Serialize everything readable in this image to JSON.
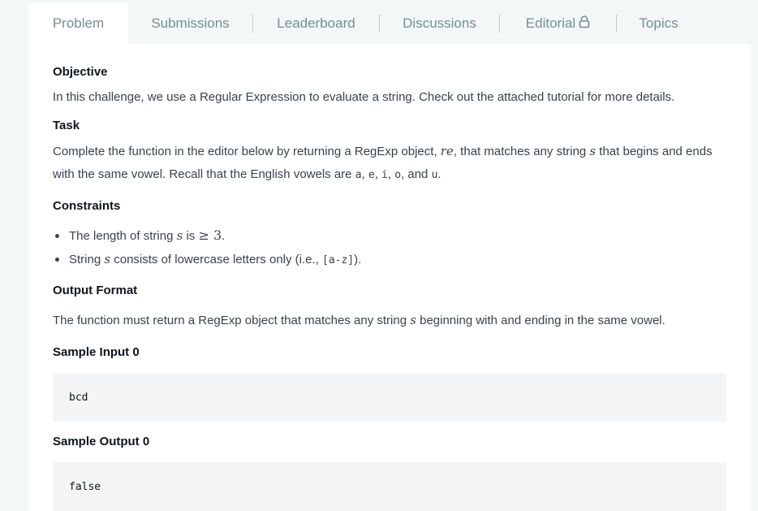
{
  "tabs": [
    {
      "label": "Problem",
      "active": true
    },
    {
      "label": "Submissions"
    },
    {
      "label": "Leaderboard"
    },
    {
      "label": "Discussions"
    },
    {
      "label": "Editorial"
    },
    {
      "label": "Topics"
    }
  ],
  "objective": {
    "heading": "Objective",
    "text": "In this challenge, we use a Regular Expression to evaluate a string. Check out the attached tutorial for more details."
  },
  "task": {
    "heading": "Task",
    "text_part1": "Complete the function in the editor below by returning a RegExp object, ",
    "var_re": "re",
    "text_part2": ", that matches any string ",
    "var_s": "s",
    "text_part3": " that begins and ends with the same vowel. Recall that the English vowels are ",
    "vowels": [
      "a",
      "e",
      "i",
      "o",
      "u"
    ],
    "text_sep1": ", ",
    "text_and": ", and ",
    "text_end": "."
  },
  "constraints": {
    "heading": "Constraints",
    "item1_part1": "The length of string ",
    "item1_var": "s",
    "item1_part2": " is ",
    "item1_math": "≥ 3",
    "item1_end": ".",
    "item2_part1": "String ",
    "item2_var": "s",
    "item2_part2": " consists of lowercase letters only (i.e., ",
    "item2_code": "[a-z]",
    "item2_end": ")."
  },
  "output_format": {
    "heading": "Output Format",
    "text_part1": "The function must return a RegExp object that matches any string ",
    "var_s": "s",
    "text_part2": " beginning with and ending in the same vowel."
  },
  "sample_input": {
    "heading": "Sample Input 0",
    "code": "bcd"
  },
  "sample_output": {
    "heading": "Sample Output 0",
    "code": "false"
  },
  "colors": {
    "background": "#f3f7f7",
    "panel": "#ffffff",
    "tab_text": "#738f93",
    "heading": "#0e141e",
    "body_text": "#39424e",
    "code_bg": "#f3f5f6"
  },
  "icons": {
    "editorial_lock": "lock-icon"
  }
}
